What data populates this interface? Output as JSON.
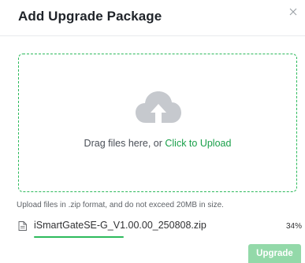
{
  "dialog": {
    "title": "Add Upgrade Package"
  },
  "dropzone": {
    "text": "Drag files here, or ",
    "link": "Click to Upload"
  },
  "tip": "Upload files in .zip format, and do not exceed 20MB in size.",
  "file": {
    "name": "iSmartGateSE-G_V1.00.00_250808.zip",
    "percent_label": "34%",
    "progress": 0.34
  },
  "actions": {
    "upgrade_label": "Upgrade"
  },
  "colors": {
    "accent": "#2dba5c",
    "link": "#1aa04a",
    "button_disabled": "#93d9a9",
    "cloud_icon": "#c6c9ce"
  }
}
